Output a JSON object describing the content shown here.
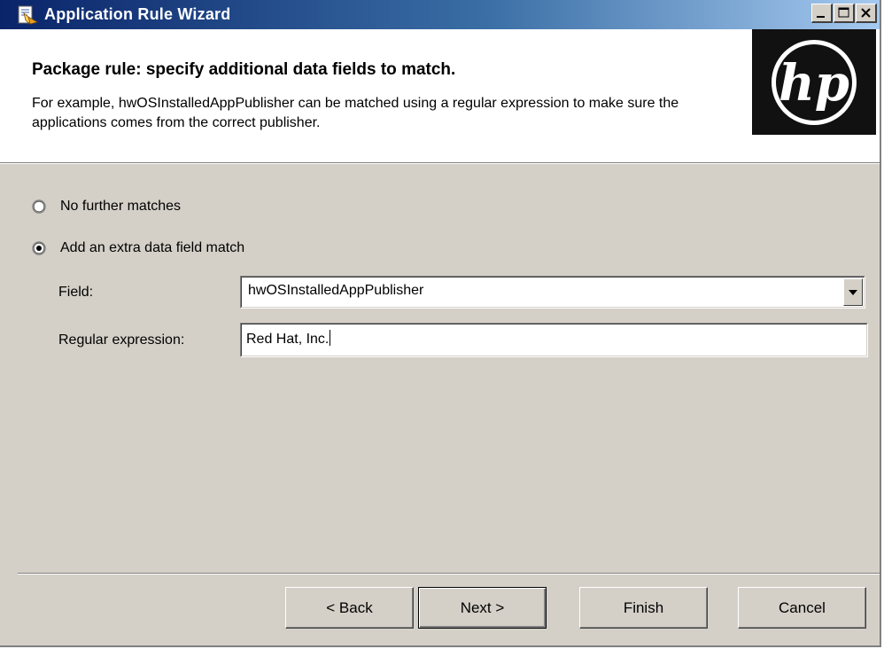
{
  "window": {
    "title": "Application Rule Wizard",
    "colors": {
      "titlebar_start": "#0a246a",
      "titlebar_end": "#a6caf0",
      "face": "#d4d0c8"
    },
    "icons": [
      "wizard-app-icon",
      "minimize-icon",
      "maximize-icon",
      "close-icon"
    ]
  },
  "header": {
    "title": "Package rule: specify additional data fields to match.",
    "description": "For example, hwOSInstalledAppPublisher can be matched using a regular expression to make sure the applications comes from the correct publisher.",
    "logo": "hp-logo"
  },
  "options": [
    {
      "label": "No further matches",
      "selected": false
    },
    {
      "label": "Add an extra data field match",
      "selected": true
    }
  ],
  "field": {
    "label": "Field:",
    "value": "hwOSInstalledAppPublisher"
  },
  "regex": {
    "label": "Regular expression:",
    "value": "Red Hat, Inc."
  },
  "buttons": {
    "back": "< Back",
    "next": "Next >",
    "finish": "Finish",
    "cancel": "Cancel"
  }
}
